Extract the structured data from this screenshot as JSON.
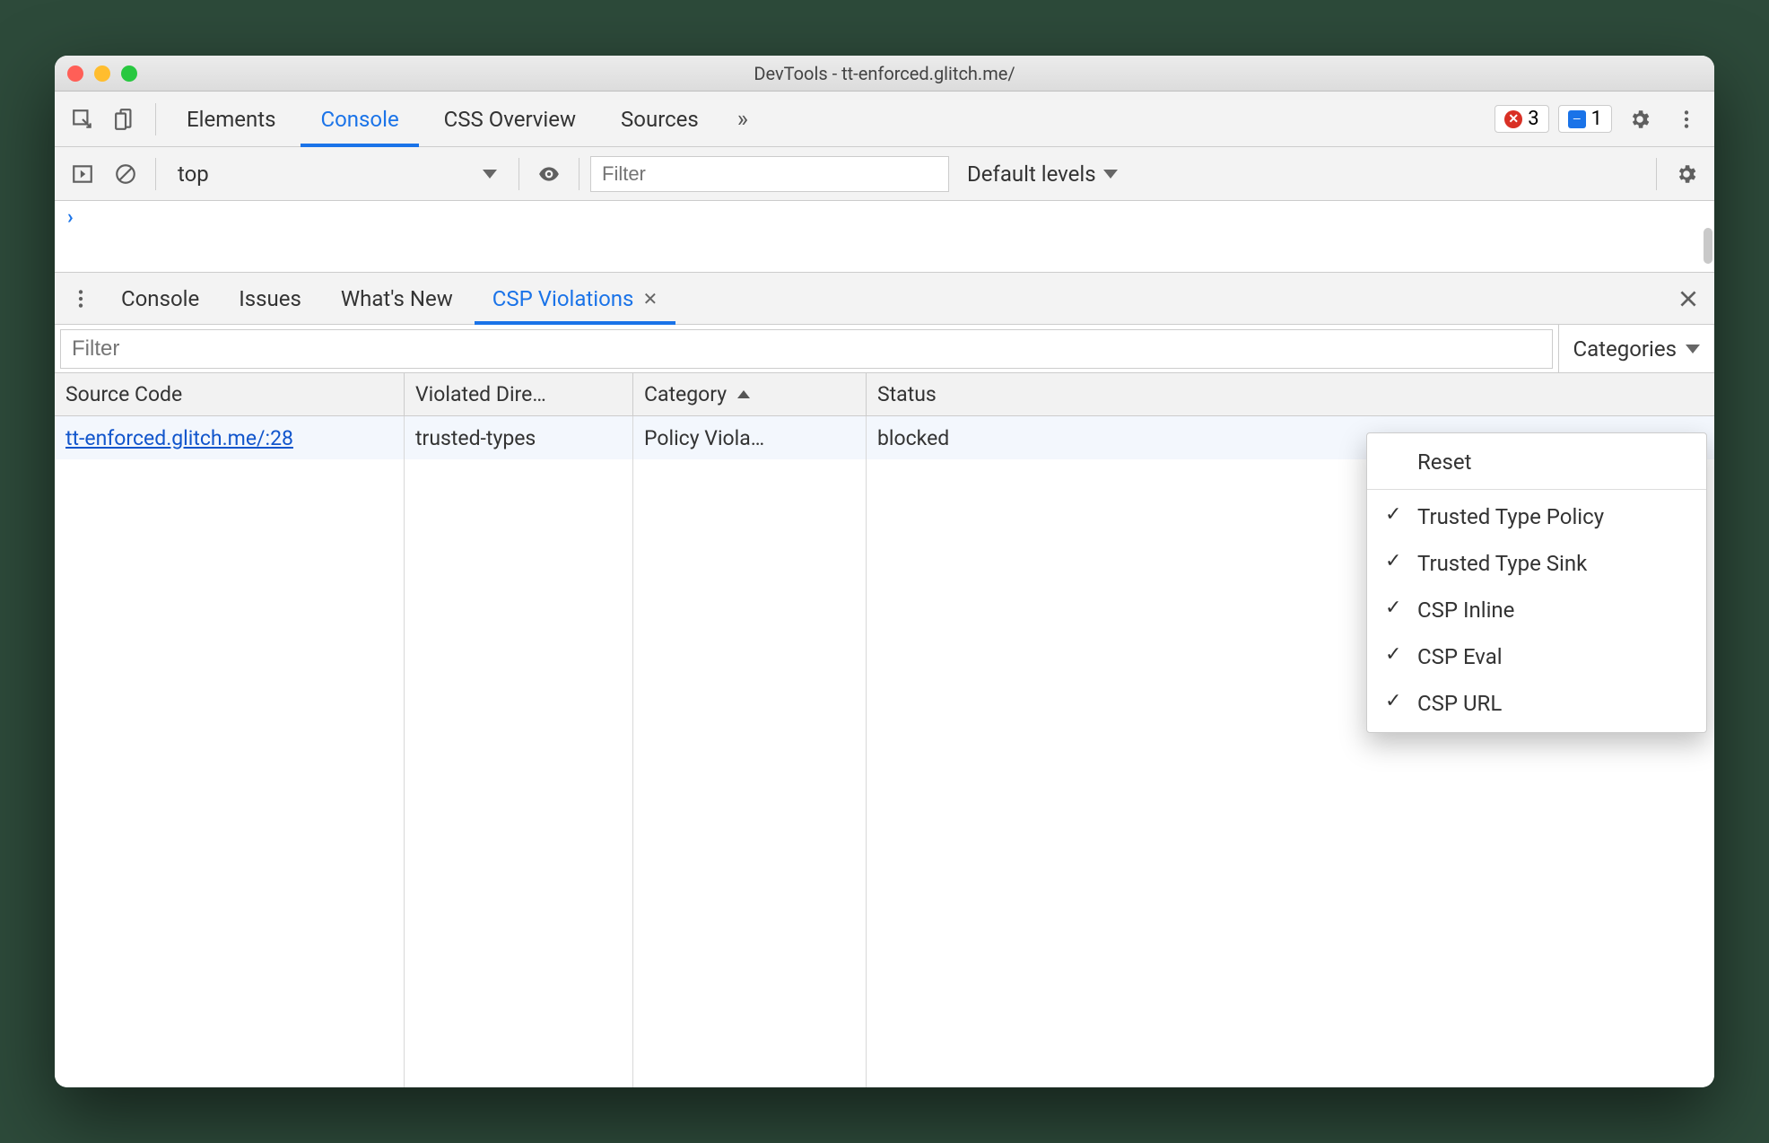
{
  "window": {
    "title": "DevTools - tt-enforced.glitch.me/"
  },
  "mainTabs": {
    "items": [
      "Elements",
      "Console",
      "CSS Overview",
      "Sources"
    ],
    "active": "Console",
    "overflow": "»",
    "errorCount": "3",
    "issueCount": "1"
  },
  "consoleToolbar": {
    "context": "top",
    "filterPlaceholder": "Filter",
    "levels": "Default levels"
  },
  "drawer": {
    "tabs": [
      "Console",
      "Issues",
      "What's New",
      "CSP Violations"
    ],
    "active": "CSP Violations"
  },
  "violations": {
    "filterPlaceholder": "Filter",
    "categoriesLabel": "Categories",
    "columns": {
      "source": "Source Code",
      "directive": "Violated Dire…",
      "category": "Category",
      "status": "Status"
    },
    "rows": [
      {
        "source": "tt-enforced.glitch.me/:28",
        "directive": "trusted-types",
        "category": "Policy Viola…",
        "status": "blocked"
      }
    ]
  },
  "categoriesMenu": {
    "reset": "Reset",
    "items": [
      "Trusted Type Policy",
      "Trusted Type Sink",
      "CSP Inline",
      "CSP Eval",
      "CSP URL"
    ]
  }
}
